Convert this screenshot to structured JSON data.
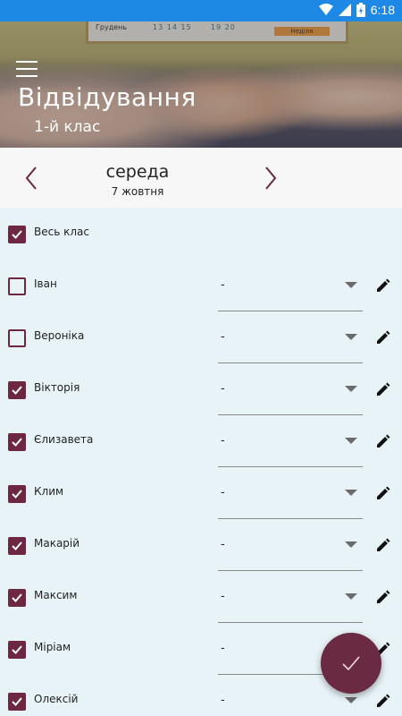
{
  "status_bar": {
    "time": "6:18",
    "icons": [
      "wifi-icon",
      "signal-icon",
      "battery-icon"
    ]
  },
  "header": {
    "title": "Відвідування",
    "subtitle": "1-й клас",
    "menu_icon": "hamburger-menu-icon",
    "board_texts": [
      "Грудень",
      "13 14 15",
      "19 20",
      "Неділя"
    ]
  },
  "date_bar": {
    "day": "середа",
    "date": "7 жовтня",
    "prev_icon": "chevron-left-icon",
    "next_icon": "chevron-right-icon"
  },
  "whole_class": {
    "label": "Весь клас",
    "checked": true
  },
  "students": [
    {
      "name": " Іван",
      "checked": false,
      "status": "-"
    },
    {
      "name": "Вероніка",
      "checked": false,
      "status": "-"
    },
    {
      "name": "Вікторія",
      "checked": true,
      "status": "-"
    },
    {
      "name": "Єлизавета",
      "checked": true,
      "status": "-"
    },
    {
      "name": "Клим",
      "checked": true,
      "status": "-"
    },
    {
      "name": "Макарій",
      "checked": true,
      "status": "-"
    },
    {
      "name": "Максим",
      "checked": true,
      "status": "-"
    },
    {
      "name": "Міріам",
      "checked": true,
      "status": "-"
    },
    {
      "name": "Олексій",
      "checked": true,
      "status": "-"
    }
  ],
  "colors": {
    "accent": "#6d2740",
    "status_bar": "#1e88e5",
    "list_bg": "#e8f3f8",
    "fab": "#6a2a41"
  },
  "fab": {
    "icon": "checkmark-icon"
  }
}
